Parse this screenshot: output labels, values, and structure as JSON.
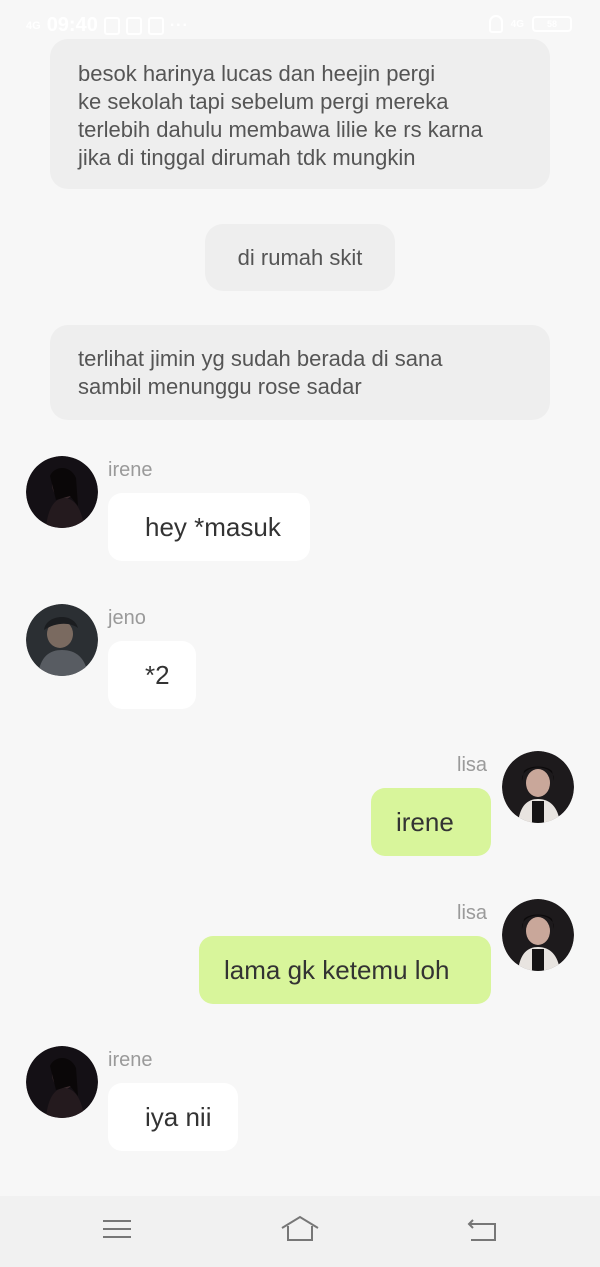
{
  "status_bar": {
    "network": "4G",
    "time": "09:40",
    "more": "···",
    "network_right": "4G",
    "battery": "58"
  },
  "narration": [
    {
      "lines": [
        "besok harinya lucas dan heejin pergi",
        "ke sekolah tapi sebelum pergi mereka",
        "terlebih dahulu membawa lilie ke rs karna",
        "jika di tinggal dirumah tdk mungkin"
      ]
    },
    {
      "lines": [
        "di rumah skit"
      ]
    },
    {
      "lines": [
        "terlihat jimin yg sudah berada di sana",
        "sambil menunggu rose sadar"
      ]
    }
  ],
  "messages": [
    {
      "sender": "irene",
      "text": "hey *masuk",
      "side": "left"
    },
    {
      "sender": "jeno",
      "text": "*2",
      "side": "left"
    },
    {
      "sender": "lisa",
      "text": "irene",
      "side": "right"
    },
    {
      "sender": "lisa",
      "text": "lama gk ketemu loh",
      "side": "right"
    },
    {
      "sender": "irene",
      "text": "iya nii",
      "side": "left"
    }
  ],
  "nav_bar": {
    "icons": [
      "menu-icon",
      "home-icon",
      "back-icon"
    ]
  },
  "colors": {
    "background": "#f7f7f7",
    "narration_bubble": "#eeeeee",
    "incoming_bubble": "#ffffff",
    "outgoing_bubble": "#d8f59b",
    "name_text": "#9a9a9a"
  }
}
